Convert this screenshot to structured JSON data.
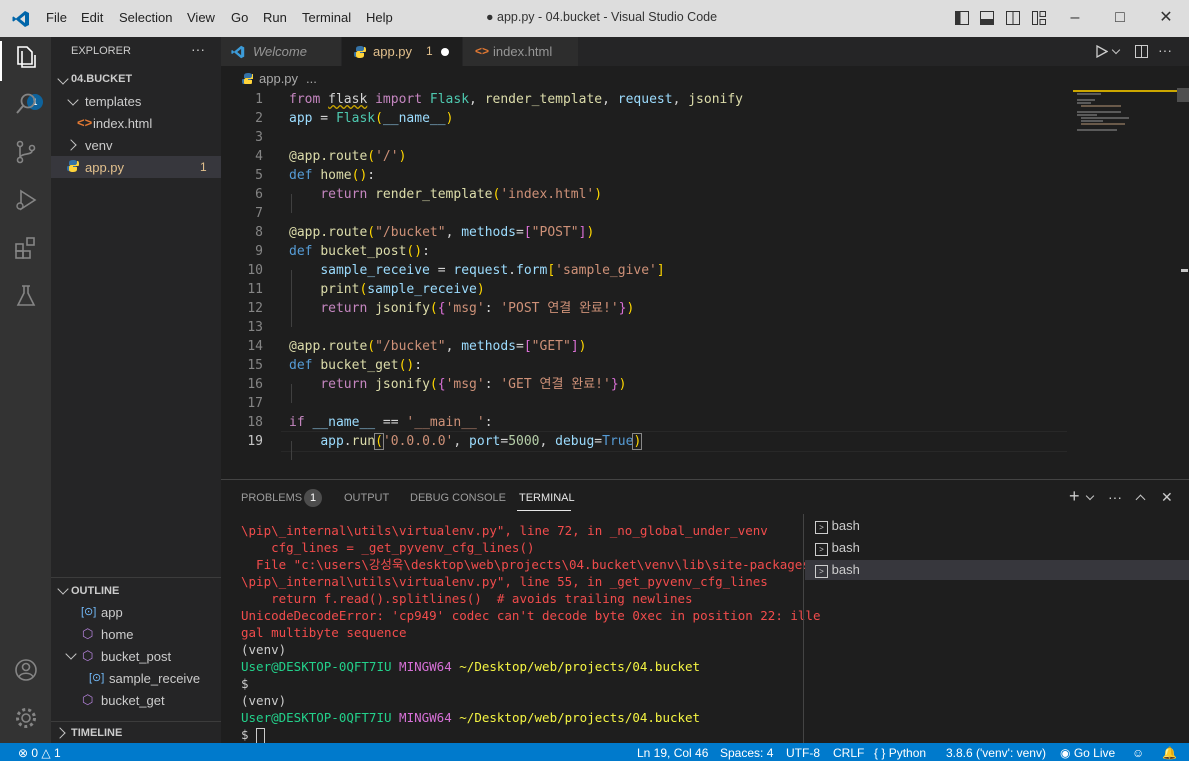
{
  "menu": [
    "File",
    "Edit",
    "Selection",
    "View",
    "Go",
    "Run",
    "Terminal",
    "Help"
  ],
  "window_title": "● app.py - 04.bucket - Visual Studio Code",
  "activity": {
    "explorer_badge": "1"
  },
  "sidebar": {
    "explorer_title": "EXPLORER",
    "more": "···",
    "folder": "04.BUCKET",
    "tree": [
      {
        "label": "templates"
      },
      {
        "label": "index.html"
      },
      {
        "label": "venv"
      },
      {
        "label": "app.py",
        "badge": "1"
      }
    ],
    "outline_title": "OUTLINE",
    "outline": [
      {
        "label": "app"
      },
      {
        "label": "home"
      },
      {
        "label": "bucket_post"
      },
      {
        "label": "sample_receive"
      },
      {
        "label": "bucket_get"
      }
    ],
    "timeline_title": "TIMELINE"
  },
  "tabs": [
    {
      "label": "Welcome"
    },
    {
      "label": "app.py",
      "badge": "1"
    },
    {
      "label": "index.html"
    }
  ],
  "breadcrumb": {
    "file": "app.py",
    "rest": "..."
  },
  "code": {
    "line_numbers": [
      "1",
      "2",
      "3",
      "4",
      "5",
      "6",
      "7",
      "8",
      "9",
      "10",
      "11",
      "12",
      "13",
      "14",
      "15",
      "16",
      "17",
      "18",
      "19"
    ],
    "lines": [
      "from flask import Flask, render_template, request, jsonify",
      "app = Flask(__name__)",
      "",
      "@app.route('/')",
      "def home():",
      "    return render_template('index.html')",
      "",
      "@app.route(\"/bucket\", methods=[\"POST\"])",
      "def bucket_post():",
      "    sample_receive = request.form['sample_give']",
      "    print(sample_receive)",
      "    return jsonify({'msg': 'POST 연결 완료!'})",
      "",
      "@app.route(\"/bucket\", methods=[\"GET\"])",
      "def bucket_get():",
      "    return jsonify({'msg': 'GET 연결 완료!'})",
      "",
      "if __name__ == '__main__':",
      "    app.run('0.0.0.0', port=5000, debug=True)"
    ]
  },
  "panel": {
    "tabs": [
      "PROBLEMS",
      "OUTPUT",
      "DEBUG CONSOLE",
      "TERMINAL"
    ],
    "problems_count": "1",
    "terminal": [
      "\\pip\\_internal\\utils\\virtualenv.py\", line 72, in _no_global_under_venv",
      "    cfg_lines = _get_pyvenv_cfg_lines()",
      "  File \"c:\\users\\강성욱\\desktop\\web\\projects\\04.bucket\\venv\\lib\\site-packages",
      "\\pip\\_internal\\utils\\virtualenv.py\", line 55, in _get_pyvenv_cfg_lines",
      "    return f.read().splitlines()  # avoids trailing newlines",
      "UnicodeDecodeError: 'cp949' codec can't decode byte 0xec in position 22: ille",
      "gal multibyte sequence"
    ],
    "prompt": {
      "venv": "(venv)",
      "user": "User@DESKTOP-0QFT7IU",
      "shell": "MINGW64",
      "path": "~/Desktop/web/projects/04.bucket",
      "dollar": "$"
    },
    "sessions": [
      "bash",
      "bash",
      "bash"
    ]
  },
  "status": {
    "errors": "0",
    "warnings": "1",
    "position": "Ln 19, Col 46",
    "spaces": "Spaces: 4",
    "encoding": "UTF-8",
    "eol": "CRLF",
    "language": "Python",
    "interpreter": "3.8.6 ('venv': venv)",
    "golive": "Go Live"
  }
}
